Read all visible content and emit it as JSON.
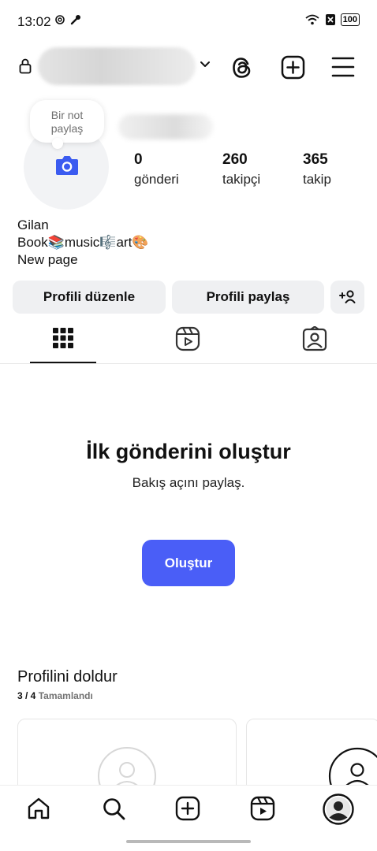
{
  "status": {
    "time": "13:02",
    "battery": "100"
  },
  "header": {
    "username_hidden": true
  },
  "note": {
    "line1": "Bir not",
    "line2": "paylaş"
  },
  "stats": [
    {
      "value": "0",
      "label": "gönderi"
    },
    {
      "value": "260",
      "label": "takipçi"
    },
    {
      "value": "365",
      "label": "takip"
    }
  ],
  "bio": {
    "name": "Gilan",
    "line2": "Book📚music🎼art🎨",
    "line3": "New page"
  },
  "actions": {
    "edit_profile": "Profili düzenle",
    "share_profile": "Profili paylaş"
  },
  "empty_state": {
    "title": "İlk gönderini oluştur",
    "subtitle": "Bakış açını paylaş.",
    "button": "Oluştur"
  },
  "complete_profile": {
    "title": "Profilini doldur",
    "progress": "3 / 4",
    "progress_label": "Tamamlandı"
  },
  "colors": {
    "accent": "#4a5ef7",
    "button_bg": "#eff0f2"
  }
}
